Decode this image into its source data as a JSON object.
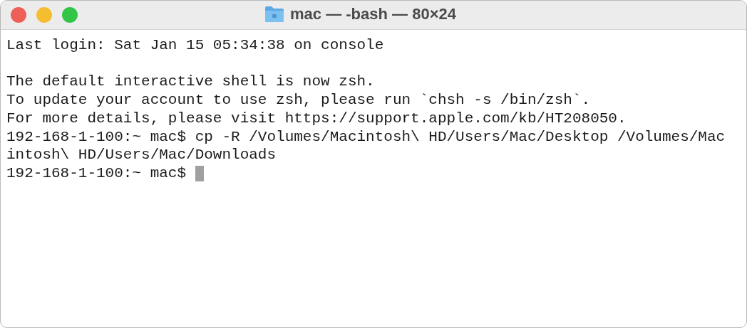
{
  "window": {
    "title": "mac — -bash — 80×24"
  },
  "lines": [
    {
      "kind": "output",
      "text": "Last login: Sat Jan 15 05:34:38 on console"
    },
    {
      "kind": "blank"
    },
    {
      "kind": "output",
      "text": "The default interactive shell is now zsh."
    },
    {
      "kind": "output",
      "text": "To update your account to use zsh, please run `chsh -s /bin/zsh`."
    },
    {
      "kind": "output",
      "text": "For more details, please visit https://support.apple.com/kb/HT208050."
    },
    {
      "kind": "output",
      "text": "192-168-1-100:~ mac$ cp -R /Volumes/Macintosh\\ HD/Users/Mac/Desktop /Volumes/Mac"
    },
    {
      "kind": "output",
      "text": "intosh\\ HD/Users/Mac/Downloads"
    }
  ],
  "prompt": {
    "text": "192-168-1-100:~ mac$",
    "cursor": true
  }
}
